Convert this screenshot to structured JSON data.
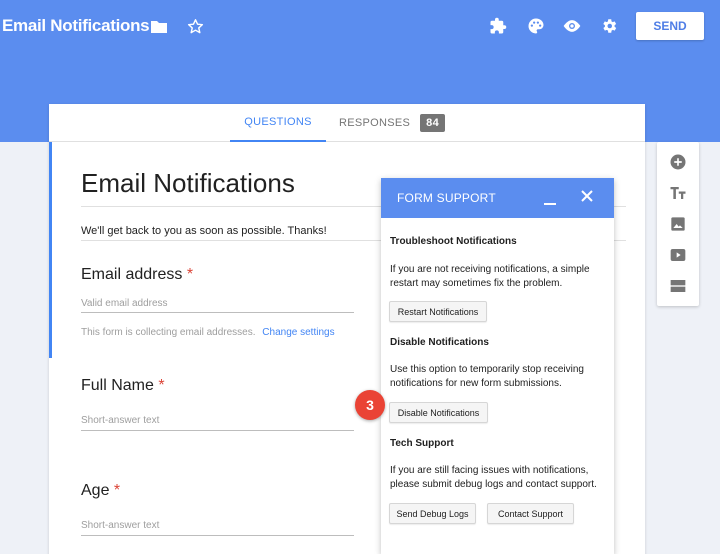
{
  "header": {
    "app_title": "Email Notifications",
    "send_label": "SEND",
    "icons": [
      "folder-icon",
      "star-icon",
      "addon-puzzle-icon",
      "palette-icon",
      "preview-eye-icon",
      "settings-gear-icon"
    ]
  },
  "tabs": {
    "questions_label": "QUESTIONS",
    "responses_label": "RESPONSES",
    "responses_count": "84"
  },
  "form": {
    "title": "Email Notifications",
    "description": "We'll get back to you as soon as possible. Thanks!",
    "questions": [
      {
        "title": "Email address",
        "required_mark": "*",
        "placeholder": "Valid email address"
      },
      {
        "title": "Full Name",
        "required_mark": "*",
        "placeholder": "Short-answer text"
      },
      {
        "title": "Age",
        "required_mark": "*",
        "placeholder": "Short-answer text"
      }
    ],
    "collect_note": "This form is collecting email addresses.",
    "change_settings_label": "Change settings"
  },
  "side_toolbar": {
    "tools": [
      "add-question-icon",
      "add-title-text-icon",
      "add-image-icon",
      "add-video-icon",
      "add-section-icon"
    ]
  },
  "panel": {
    "title": "FORM SUPPORT",
    "sections": [
      {
        "title": "Troubleshoot Notifications",
        "body": "If you are not receiving notifications, a simple restart may sometimes fix the problem.",
        "button": "Restart Notifications"
      },
      {
        "title": "Disable Notifications",
        "body": "Use this option to temporarily stop receiving notifications for new form submissions.",
        "button": "Disable Notifications"
      },
      {
        "title": "Tech Support",
        "body": "If you are still facing issues with notifications, please submit debug logs and contact support.",
        "button": "Send Debug Logs",
        "button2": "Contact Support"
      }
    ]
  },
  "step_marker": "3",
  "colors": {
    "header_blue": "#5b8def",
    "accent_blue": "#4285f4",
    "required_red": "#db4437",
    "marker_red": "#ea4335"
  }
}
